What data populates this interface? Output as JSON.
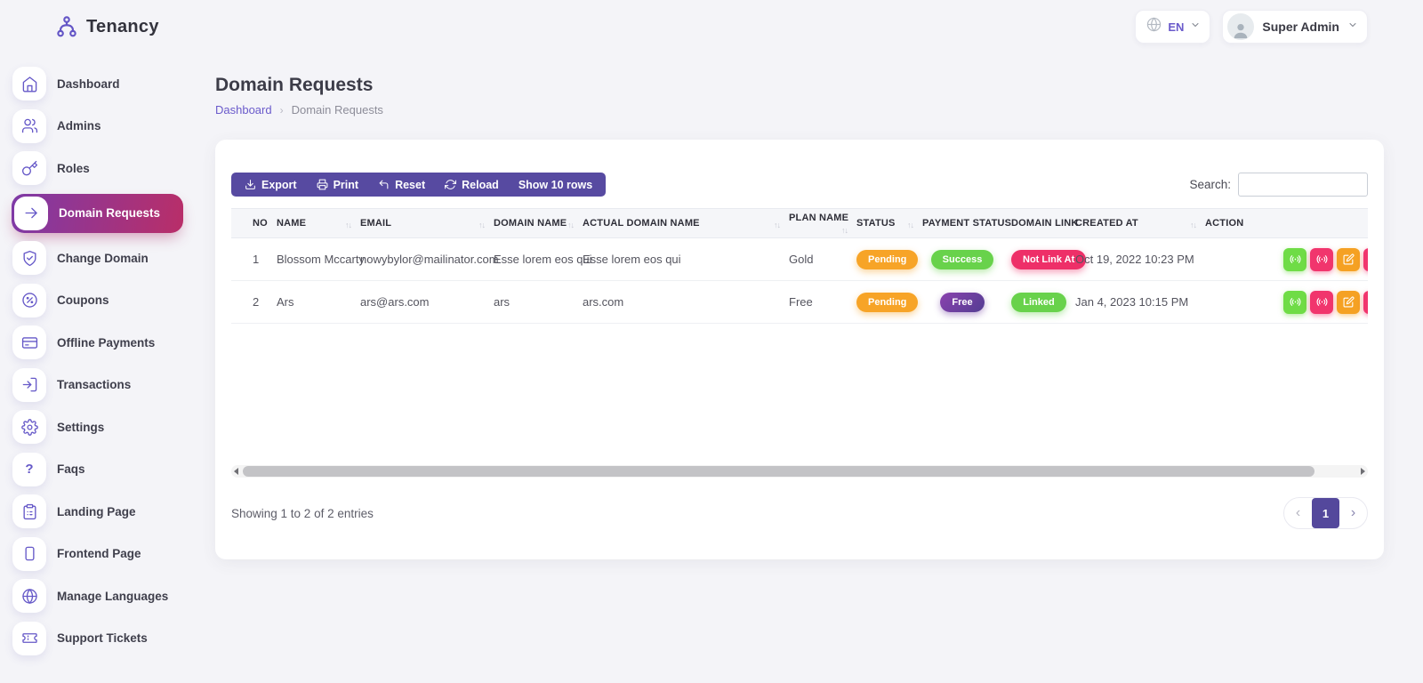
{
  "header": {
    "brand": "Tenancy",
    "language_code": "EN",
    "user_name": "Super Admin"
  },
  "sidebar": {
    "items": [
      {
        "label": "Dashboard",
        "icon": "home-icon",
        "active": false
      },
      {
        "label": "Admins",
        "icon": "users-icon",
        "active": false
      },
      {
        "label": "Roles",
        "icon": "key-icon",
        "active": false
      },
      {
        "label": "Domain Requests",
        "icon": "arrow-right-icon",
        "active": true
      },
      {
        "label": "Change Domain",
        "icon": "shield-check-icon",
        "active": false
      },
      {
        "label": "Coupons",
        "icon": "discount-icon",
        "active": false
      },
      {
        "label": "Offline Payments",
        "icon": "credit-card-icon",
        "active": false
      },
      {
        "label": "Transactions",
        "icon": "transaction-icon",
        "active": false
      },
      {
        "label": "Settings",
        "icon": "gear-icon",
        "active": false
      },
      {
        "label": "Faqs",
        "icon": "question-icon",
        "active": false
      },
      {
        "label": "Landing Page",
        "icon": "clipboard-icon",
        "active": false
      },
      {
        "label": "Frontend Page",
        "icon": "page-icon",
        "active": false
      },
      {
        "label": "Manage Languages",
        "icon": "globe-icon",
        "active": false
      },
      {
        "label": "Support Tickets",
        "icon": "ticket-icon",
        "active": false
      }
    ]
  },
  "page": {
    "title": "Domain Requests",
    "breadcrumb": {
      "parent": "Dashboard",
      "separator": "›",
      "current": "Domain Requests"
    }
  },
  "toolbar": {
    "buttons": {
      "export": "Export",
      "print": "Print",
      "reset": "Reset",
      "reload": "Reload",
      "show_rows": "Show 10 rows"
    },
    "search_label": "Search:",
    "search_value": ""
  },
  "table": {
    "sort_glyph": "↑↓",
    "columns": [
      {
        "label": "NO",
        "sortable": false
      },
      {
        "label": "NAME",
        "sortable": true
      },
      {
        "label": "EMAIL",
        "sortable": true
      },
      {
        "label": "DOMAIN NAME",
        "sortable": true
      },
      {
        "label": "ACTUAL DOMAIN NAME",
        "sortable": true
      },
      {
        "label": "PLAN NAME",
        "sortable": true
      },
      {
        "label": "STATUS",
        "sortable": true
      },
      {
        "label": "PAYMENT STATUS",
        "sortable": false
      },
      {
        "label": "DOMAIN LINK",
        "sortable": false
      },
      {
        "label": "CREATED AT",
        "sortable": true
      },
      {
        "label": "ACTION",
        "sortable": false
      }
    ],
    "rows": [
      {
        "no": "1",
        "name": "Blossom Mccarty",
        "email": "nowybylor@mailinator.com",
        "domain_name": "Esse lorem eos qui",
        "actual_domain_name": "Esse lorem eos qui",
        "plan_name": "Gold",
        "status": {
          "label": "Pending",
          "variant": "warning"
        },
        "payment_status": {
          "label": "Success",
          "variant": "success"
        },
        "domain_link": {
          "label": "Not Link At",
          "variant": "danger"
        },
        "created_at": "Oct 19, 2022 10:23 PM",
        "actions": [
          "broadcast",
          "broadcast",
          "edit",
          "delete"
        ]
      },
      {
        "no": "2",
        "name": "Ars",
        "email": "ars@ars.com",
        "domain_name": "ars",
        "actual_domain_name": "ars.com",
        "plan_name": "Free",
        "status": {
          "label": "Pending",
          "variant": "warning"
        },
        "payment_status": {
          "label": "Free",
          "variant": "purple"
        },
        "domain_link": {
          "label": "Linked",
          "variant": "success"
        },
        "created_at": "Jan 4, 2023 10:15 PM",
        "actions": [
          "broadcast",
          "broadcast",
          "edit",
          "delete"
        ]
      }
    ]
  },
  "footer": {
    "showing_text": "Showing 1 to 2 of 2 entries",
    "pagination": {
      "prev": "‹",
      "current": "1",
      "next": "›"
    }
  },
  "colors": {
    "page_background": "#f4f4f8",
    "accent_purple": "#574aa1",
    "icon_purple": "#6558c8",
    "active_gradient_from": "#7e3aa7",
    "active_gradient_to": "#b92e68",
    "badge_warning": "#f7a427",
    "badge_success": "#68d24b",
    "badge_danger": "#ee2f68",
    "badge_purple_from": "#8a42ae",
    "badge_purple_to": "#533d92",
    "action_green": "#6fdc46",
    "action_pink": "#f1356d",
    "action_orange": "#f5a123",
    "pagination_active": "#54489c"
  }
}
